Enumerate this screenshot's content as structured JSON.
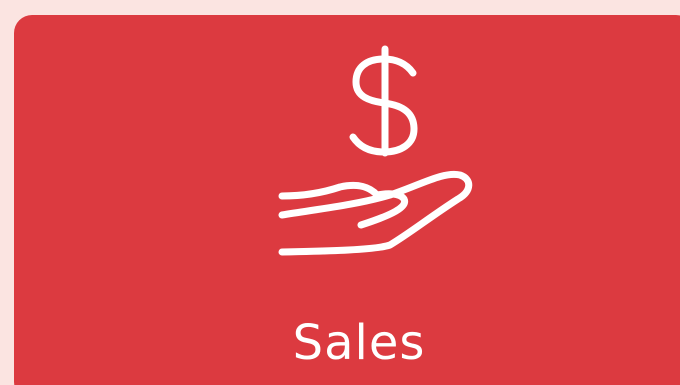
{
  "tile": {
    "label": "Sales",
    "icon": "dollar-hand-icon",
    "background_color": "#dc3a40",
    "foreground_color": "#ffffff"
  },
  "page": {
    "background_color": "#fbe4e1"
  }
}
